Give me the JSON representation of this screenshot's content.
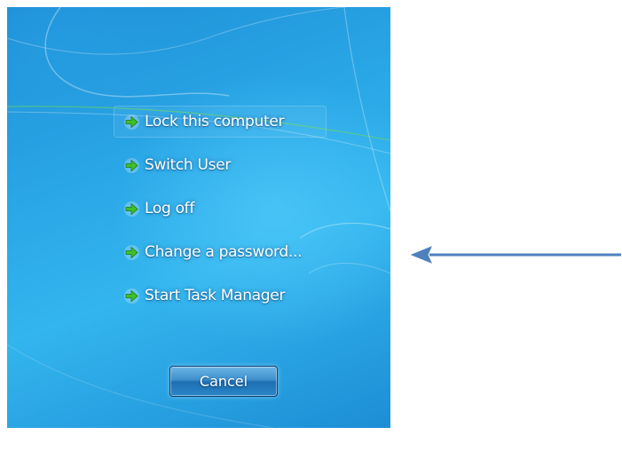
{
  "menu": {
    "items": [
      {
        "label": "Lock this computer",
        "icon": "green-arrow-icon"
      },
      {
        "label": "Switch User",
        "icon": "green-arrow-icon"
      },
      {
        "label": "Log off",
        "icon": "green-arrow-icon"
      },
      {
        "label": "Change a password...",
        "icon": "green-arrow-icon"
      },
      {
        "label": "Start Task Manager",
        "icon": "green-arrow-icon"
      }
    ]
  },
  "cancel": {
    "label": "Cancel"
  },
  "colors": {
    "background": "#29a6e6",
    "icon_green": "#3fbf2a",
    "pointer_arrow": "#4f81bd"
  }
}
